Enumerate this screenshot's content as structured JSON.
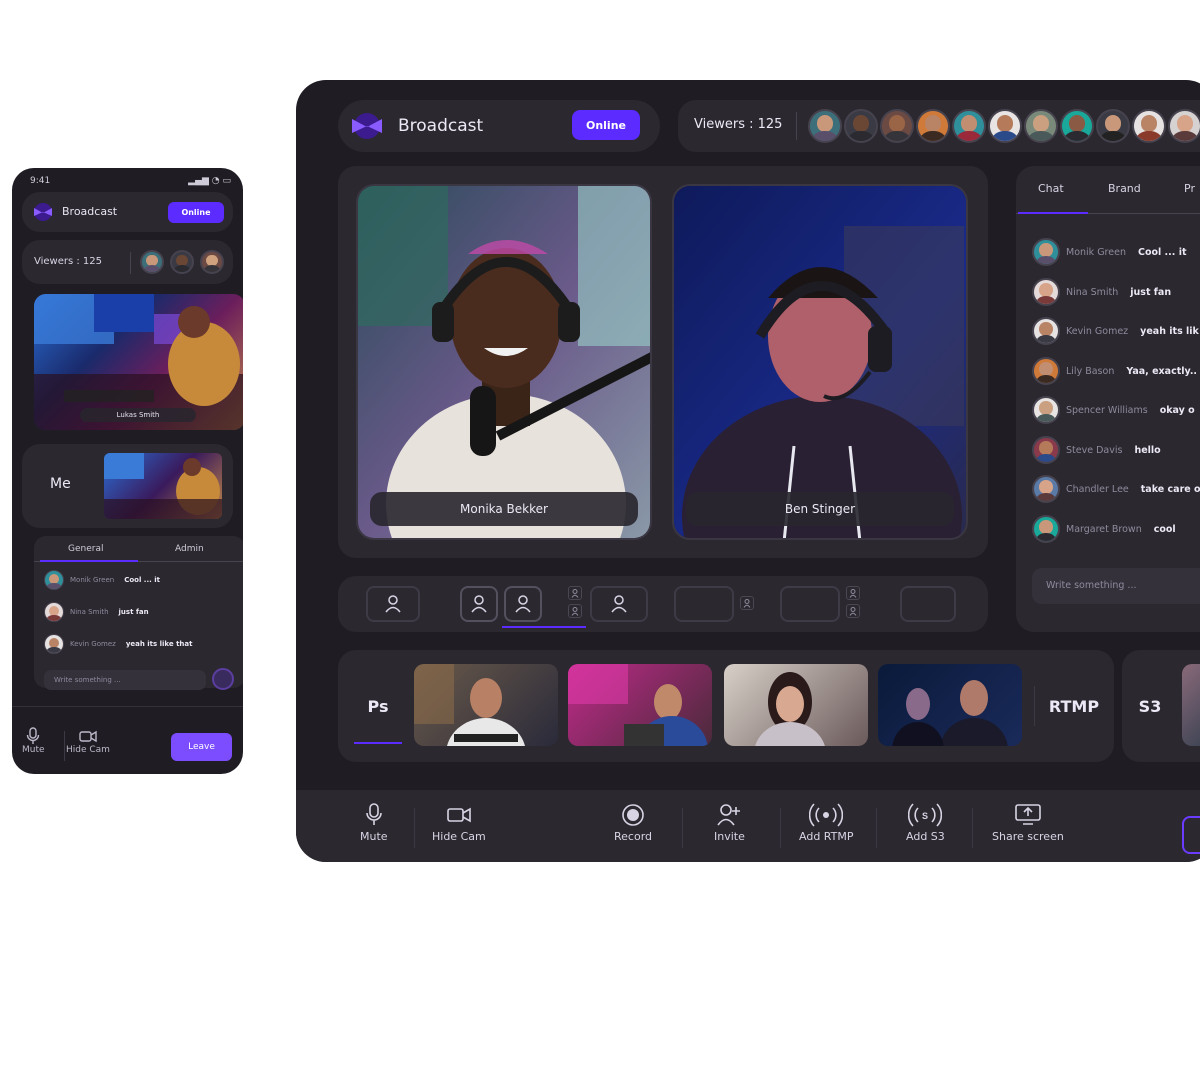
{
  "phone": {
    "status_time": "9:41",
    "title": "Broadcast",
    "online_label": "Online",
    "viewers_label": "Viewers : 125",
    "feed_name": "Lukas Smith",
    "me_label": "Me",
    "tabs": [
      "General",
      "Admin"
    ],
    "messages": [
      {
        "name": "Monik Green",
        "text": "Cool ... it"
      },
      {
        "name": "Nina Smith",
        "text": "just fan"
      },
      {
        "name": "Kevin Gomez",
        "text": "yeah its like that"
      }
    ],
    "input_placeholder": "Write something ...",
    "controls": {
      "mute": "Mute",
      "hide_cam": "Hide Cam",
      "leave": "Leave"
    }
  },
  "desktop": {
    "title": "Broadcast",
    "online_label": "Online",
    "viewers_label": "Viewers : 125",
    "speakers": [
      "Monika Bekker",
      "Ben Stinger"
    ],
    "sidebar_tabs": [
      "Chat",
      "Brand",
      "Pr"
    ],
    "messages": [
      {
        "name": "Monik Green",
        "text": "Cool ... it"
      },
      {
        "name": "Nina Smith",
        "text": "just fan"
      },
      {
        "name": "Kevin Gomez",
        "text": "yeah its lik"
      },
      {
        "name": "Lily Bason",
        "text": "Yaa, exactly.."
      },
      {
        "name": "Spencer Williams",
        "text": "okay o"
      },
      {
        "name": "Steve Davis",
        "text": "hello"
      },
      {
        "name": "Chandler Lee",
        "text": "take care o"
      },
      {
        "name": "Margaret Brown",
        "text": "cool"
      }
    ],
    "input_placeholder": "Write something ...",
    "sources": {
      "ps": "Ps",
      "rtmp": "RTMP",
      "s3": "S3"
    },
    "toolbar": {
      "mute": "Mute",
      "hide_cam": "Hide Cam",
      "record": "Record",
      "invite": "Invite",
      "add_rtmp": "Add RTMP",
      "add_s3": "Add S3",
      "share_screen": "Share screen"
    }
  },
  "colors": {
    "accent": "#5b2bff",
    "background": "#1f1d23",
    "panel": "#2b2830",
    "leave": "#7b4dff"
  },
  "icons": [
    "logo-icon",
    "mic-icon",
    "camera-icon",
    "record-icon",
    "invite-icon",
    "rtmp-icon",
    "s3-icon",
    "share-screen-icon",
    "person-icon"
  ]
}
